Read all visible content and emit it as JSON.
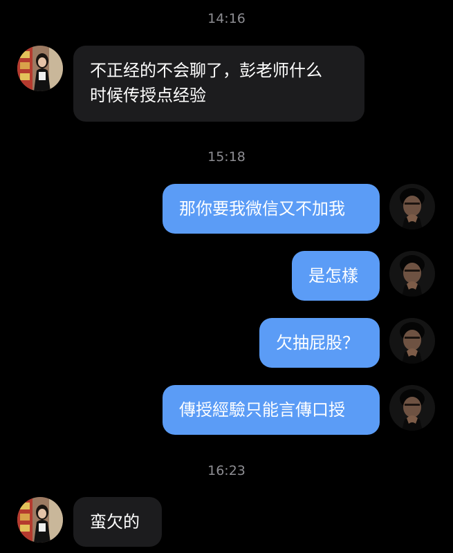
{
  "colors": {
    "background": "#000000",
    "incoming_bubble": "#1c1c1e",
    "outgoing_bubble": "#5b9cf6",
    "timestamp": "#8e8e93"
  },
  "messages": [
    {
      "type": "timestamp",
      "text": "14:16"
    },
    {
      "type": "incoming",
      "avatar": "avatar-girl",
      "lines": [
        "不正经的不会聊了，彭老师什么",
        "时候传授点经验"
      ]
    },
    {
      "type": "timestamp",
      "text": "15:18"
    },
    {
      "type": "outgoing",
      "avatar": "avatar-boy",
      "text": "那你要我微信又不加我"
    },
    {
      "type": "outgoing",
      "avatar": "avatar-boy",
      "text": "是怎樣"
    },
    {
      "type": "outgoing",
      "avatar": "avatar-boy",
      "text": "欠抽屁股？"
    },
    {
      "type": "outgoing",
      "avatar": "avatar-boy",
      "text": "傳授經驗只能言傳口授"
    },
    {
      "type": "timestamp",
      "text": "16:23"
    },
    {
      "type": "incoming",
      "avatar": "avatar-girl",
      "lines": [
        "蛮欠的"
      ]
    }
  ]
}
